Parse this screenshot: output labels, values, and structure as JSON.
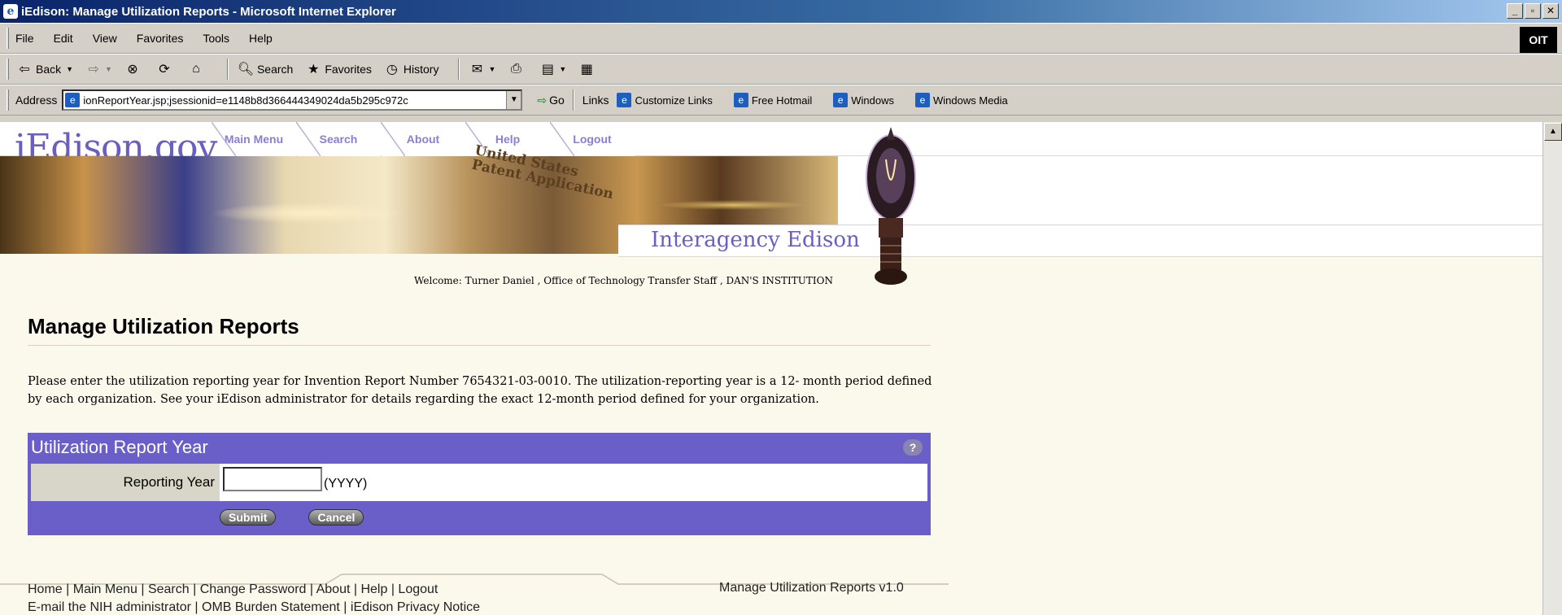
{
  "window": {
    "title": "iEdison: Manage Utilization Reports - Microsoft Internet Explorer",
    "controls": [
      "_",
      "▫",
      "✕"
    ]
  },
  "menubar": {
    "items": [
      "File",
      "Edit",
      "View",
      "Favorites",
      "Tools",
      "Help"
    ],
    "brand": "OIT"
  },
  "toolbar": {
    "back": "Back",
    "search": "Search",
    "favorites": "Favorites",
    "history": "History"
  },
  "addressbar": {
    "label": "Address",
    "url": "ionReportYear.jsp;jsessionid=e1148b8d366444349024da5b295c972c",
    "go": "Go",
    "links_label": "Links",
    "links": [
      "Customize Links",
      "Free Hotmail",
      "Windows",
      "Windows Media"
    ]
  },
  "banner": {
    "logo": "iEdison.gov",
    "nav": [
      "Main Menu",
      "Search",
      "About",
      "Help",
      "Logout"
    ],
    "stamp_line1": "United States",
    "stamp_line2": "Patent Application",
    "tagline": "Interagency Edison",
    "welcome": "Welcome: Turner  Daniel , Office of Technology Transfer Staff , DAN'S INSTITUTION"
  },
  "page": {
    "title": "Manage Utilization Reports",
    "intro": "Please enter the utilization reporting year for Invention Report Number 7654321-03-0010. The utilization-reporting year is a 12- month period defined by each organization. See your iEdison administrator for details regarding the exact 12-month period defined for your organization."
  },
  "form": {
    "header": "Utilization Report Year",
    "help_icon": "?",
    "field_label": "Reporting Year",
    "field_value": "",
    "format_hint": "(YYYY)",
    "submit": "Submit",
    "cancel": "Cancel"
  },
  "footer": {
    "links_row1": [
      "Home",
      "Main Menu",
      "Search",
      "Change Password",
      "About",
      "Help",
      "Logout"
    ],
    "links_row2": [
      "E-mail the NIH administrator",
      "OMB Burden Statement",
      "iEdison Privacy Notice"
    ],
    "version": "Manage Utilization Reports v1.0"
  }
}
